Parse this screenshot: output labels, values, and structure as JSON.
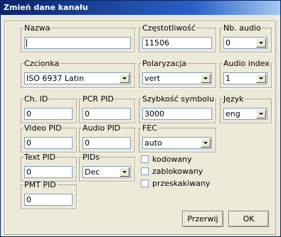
{
  "window": {
    "title": "Zmień dane kanału"
  },
  "fields": {
    "nazwa": {
      "label": "Nazwa",
      "value": ""
    },
    "czestotliwosc": {
      "label": "Częstotliwość",
      "value": "11506"
    },
    "nb_audio": {
      "label": "Nb. audio",
      "value": "0"
    },
    "czcionka": {
      "label": "Czcionka",
      "value": "ISO 6937 Latin"
    },
    "polaryzacja": {
      "label": "Polaryzacja",
      "value": "vert"
    },
    "audio_index": {
      "label": "Audio index",
      "value": "1"
    },
    "ch_id": {
      "label": "Ch. ID",
      "value": "0"
    },
    "pcr_pid": {
      "label": "PCR PID",
      "value": "0"
    },
    "szybkosc_symbolu": {
      "label": "Szybkość symbolu",
      "value": "3000"
    },
    "jezyk": {
      "label": "Język",
      "value": "eng"
    },
    "video_pid": {
      "label": "Video PID",
      "value": "0"
    },
    "audio_pid": {
      "label": "Audio PID",
      "value": "0"
    },
    "fec": {
      "label": "FEC",
      "value": "auto"
    },
    "text_pid": {
      "label": "Text PID",
      "value": "0"
    },
    "pids": {
      "label": "PIDs",
      "value": "Dec"
    },
    "pmt_pid": {
      "label": "PMT PID",
      "value": "0"
    }
  },
  "checkboxes": {
    "kodowany": {
      "label": "kodowany",
      "checked": false
    },
    "zablokowany": {
      "label": "zablokowany",
      "checked": false
    },
    "przeskakiwany": {
      "label": "przeskakiwany",
      "checked": false
    }
  },
  "buttons": {
    "cancel": "Przerwij",
    "ok": "OK"
  }
}
